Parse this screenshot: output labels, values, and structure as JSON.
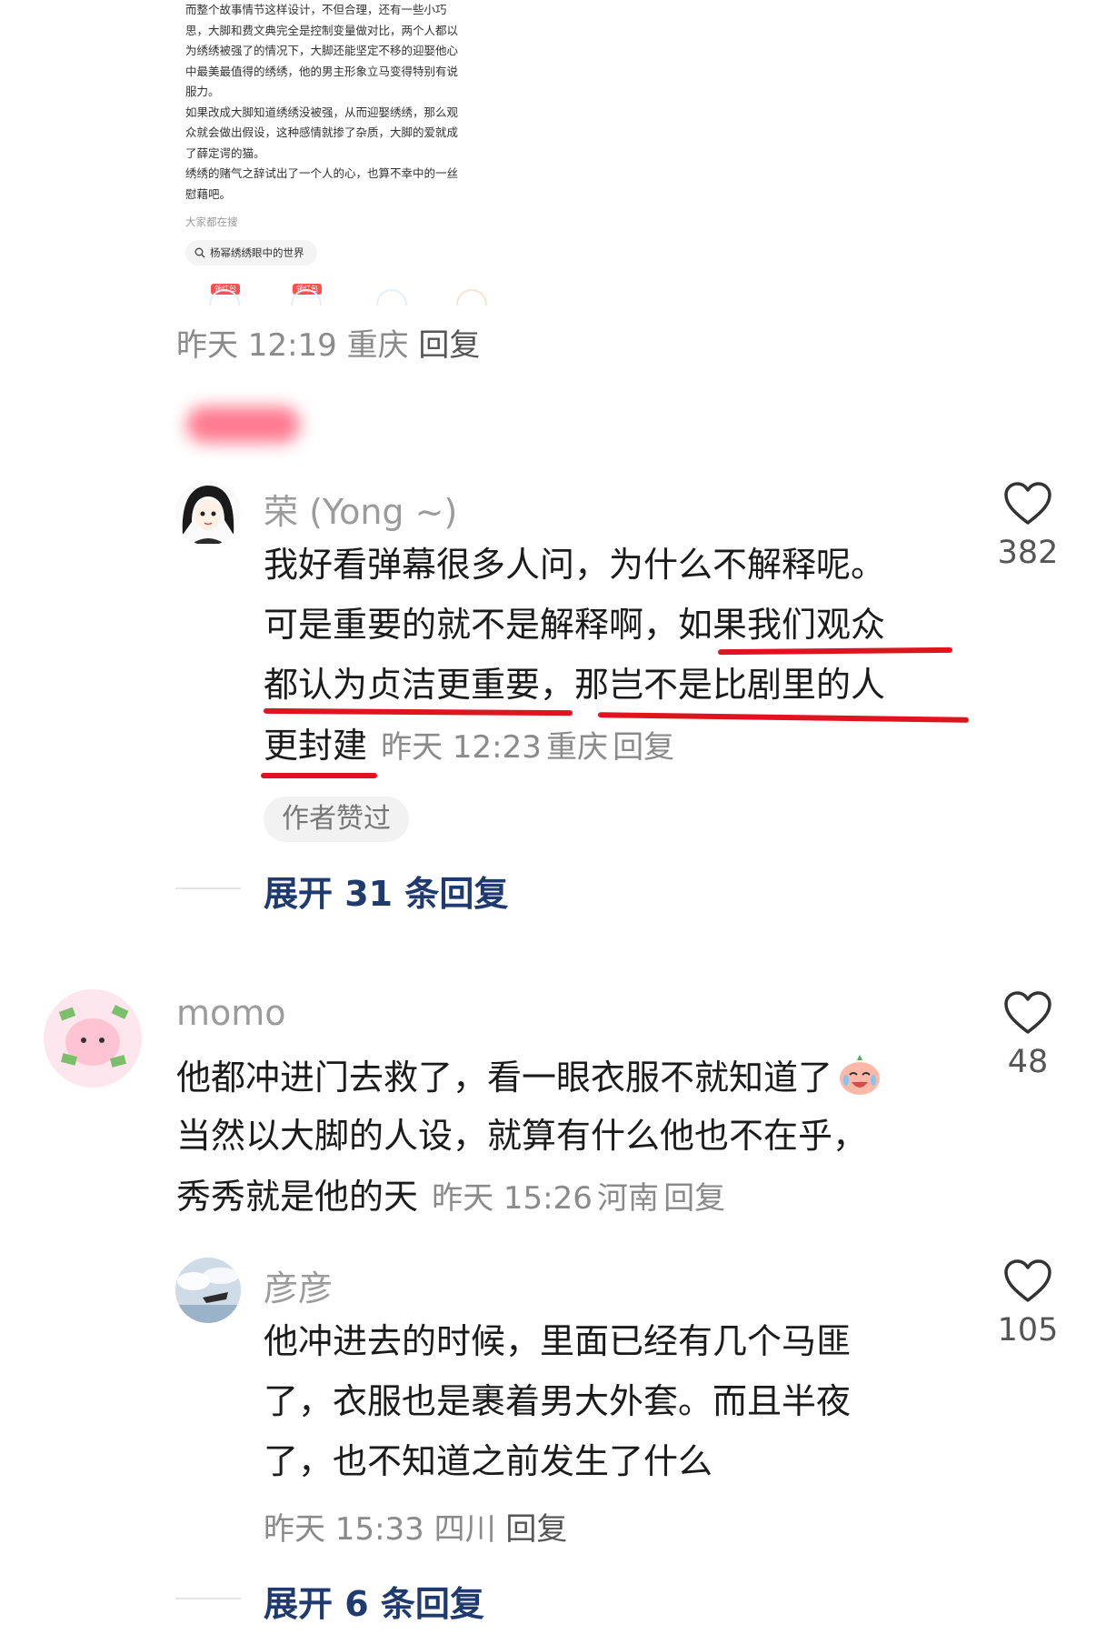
{
  "embedded_post": {
    "lines": [
      "而整个故事情节这样设计，不但合理，还有一些小巧",
      "思，大脚和费文典完全是控制变量做对比，两个人都以",
      "为绣绣被强了的情况下，大脚还能坚定不移的迎娶他心",
      "中最美最值得的绣绣，他的男主形象立马变得特别有说",
      "服力。",
      "如果改成大脚知道绣绣没被强，从而迎娶绣绣，那么观",
      "众就会做出假设，这种感情就掺了杂质，大脚的爱就成",
      "了薛定谔的猫。",
      "绣绣的赌气之辞试出了一个人的心，也算不幸中的一丝",
      "慰藉吧。"
    ],
    "search_label": "大家都在搜",
    "search_chip": "杨幂绣绣眼中的世界",
    "redpack_labels": [
      "领红包",
      "领红包"
    ]
  },
  "post_meta": {
    "time": "昨天 12:19",
    "location": "重庆",
    "reply": "回复"
  },
  "comments": [
    {
      "user": "荣 (Yong ~)",
      "lines": [
        "我好看弹幕很多人问，为什么不解释呢。",
        "可是重要的就不是解释啊，如果我们观众",
        "都认为贞洁更重要，那岂不是比剧里的人",
        "更封建"
      ],
      "time": "昨天 12:23",
      "location": "重庆",
      "reply": "回复",
      "likes": "382",
      "badge": "作者赞过",
      "expand": "展开 31 条回复"
    },
    {
      "user": "momo",
      "lines": [
        "他都冲进门去救了，看一眼衣服不就知道了",
        "当然以大脚的人设，就算有什么他也不在乎，",
        "秀秀就是他的天"
      ],
      "emoji": "crying-laughing-emoji",
      "time": "昨天 15:26",
      "location": "河南",
      "reply": "回复",
      "likes": "48"
    },
    {
      "user": "彦彦",
      "lines": [
        "他冲进去的时候，里面已经有几个马匪",
        "了，衣服也是裹着男大外套。而且半夜",
        "了，也不知道之前发生了什么"
      ],
      "time": "昨天 15:33",
      "location": "四川",
      "reply": "回复",
      "likes": "105",
      "expand": "展开 6 条回复"
    }
  ],
  "colors": {
    "underline": "#e0141e",
    "link": "#1f3a6e",
    "meta": "#8a8a8a"
  }
}
